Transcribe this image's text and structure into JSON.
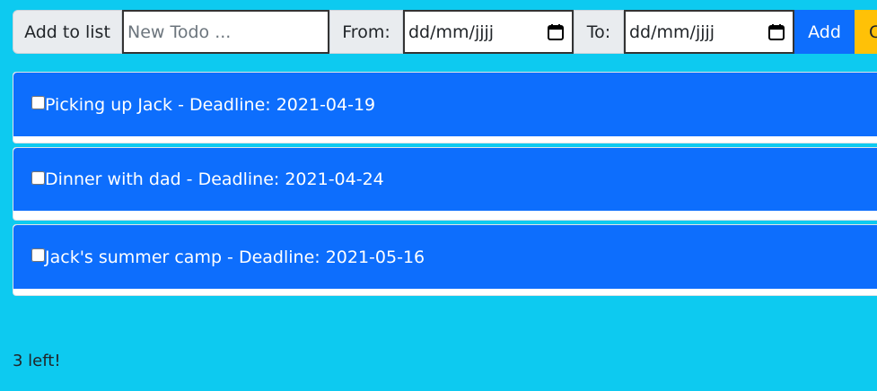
{
  "toolbar": {
    "add_to_list_label": "Add to list",
    "todo_placeholder": "New Todo ...",
    "from_label": "From:",
    "from_placeholder": "dd/mm/jjjj",
    "to_label": "To:",
    "to_placeholder": "dd/mm/jjjj",
    "add_button": "Add",
    "clear_button": "C"
  },
  "todos": [
    {
      "checked": false,
      "text": "Picking up Jack - Deadline: 2021-04-19"
    },
    {
      "checked": false,
      "text": "Dinner with dad - Deadline: 2021-04-24"
    },
    {
      "checked": false,
      "text": "Jack's summer camp - Deadline: 2021-05-16"
    }
  ],
  "status": {
    "remaining_text": "3 left!"
  },
  "colors": {
    "background": "#0dcaf0",
    "primary": "#0d6efd",
    "warning": "#ffc107"
  }
}
